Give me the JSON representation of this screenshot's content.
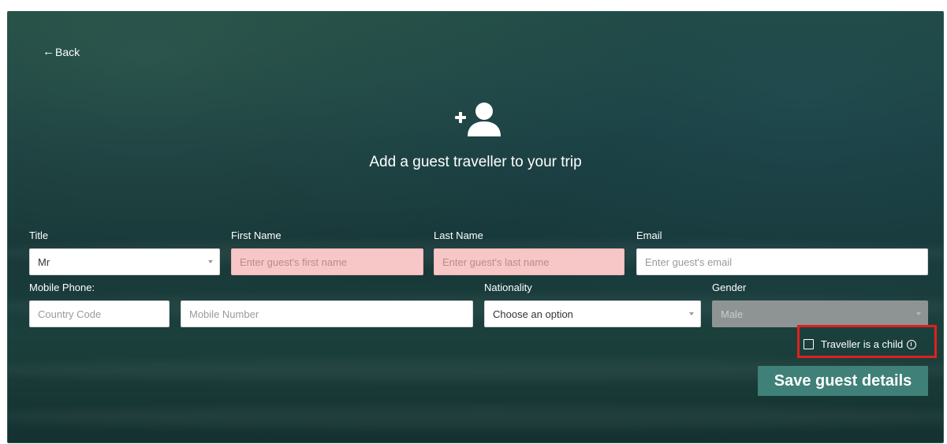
{
  "header": {
    "back_label": "Back",
    "title": "Add a guest traveller to your trip"
  },
  "form": {
    "title": {
      "label": "Title",
      "value": "Mr"
    },
    "first_name": {
      "label": "First Name",
      "placeholder": "Enter guest's first name",
      "value": ""
    },
    "last_name": {
      "label": "Last Name",
      "placeholder": "Enter guest's last name",
      "value": ""
    },
    "email": {
      "label": "Email",
      "placeholder": "Enter guest's email",
      "value": ""
    },
    "mobile": {
      "label": "Mobile Phone:",
      "country_code_placeholder": "Country Code",
      "number_placeholder": "Mobile Number"
    },
    "nationality": {
      "label": "Nationality",
      "value": "Choose an option"
    },
    "gender": {
      "label": "Gender",
      "value": "Male",
      "disabled": true
    },
    "child_checkbox": {
      "label": "Traveller is a child",
      "checked": false
    }
  },
  "actions": {
    "save_label": "Save guest details"
  },
  "colors": {
    "accent": "#3f8078",
    "invalid_field": "#f7c6c6",
    "highlight": "#e0201f"
  },
  "icons": {
    "back": "arrow-left-icon",
    "header": "add-user-icon",
    "select": "caret-down-icon",
    "info": "info-icon"
  }
}
